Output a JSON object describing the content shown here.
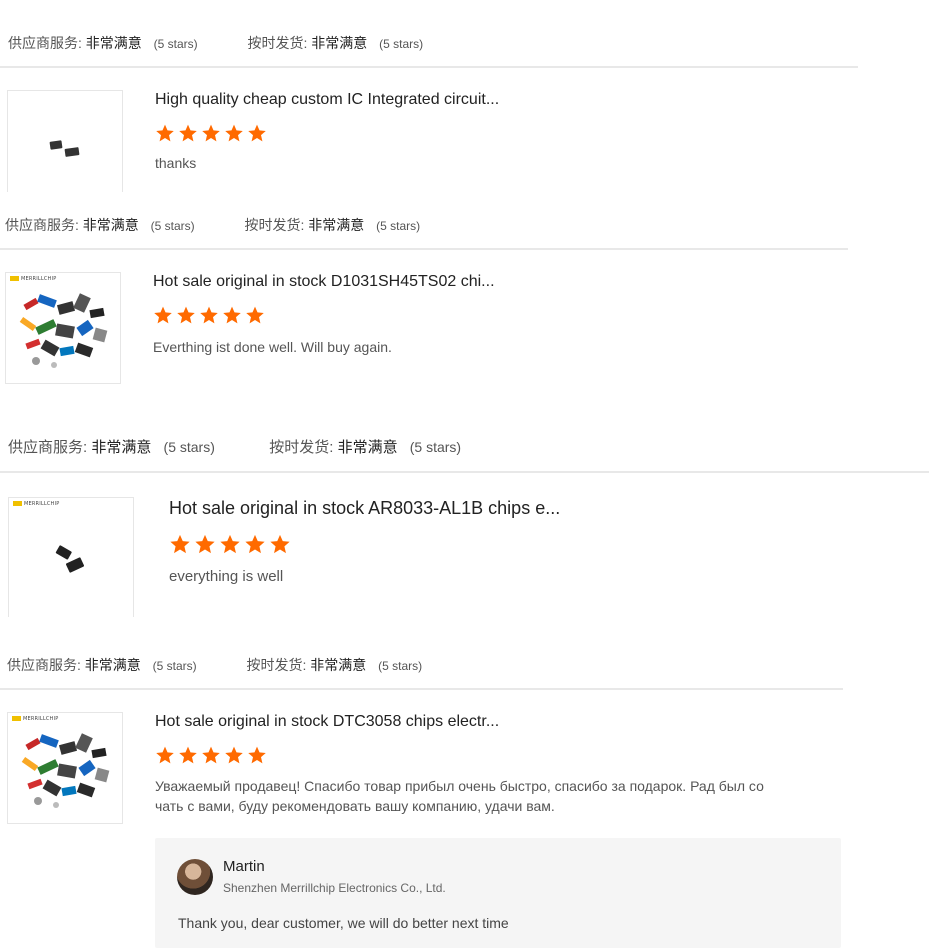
{
  "ratings": [
    {
      "service_label": "供应商服务:",
      "service_value": "非常满意",
      "service_stars": "(5 stars)",
      "delivery_label": "按时发货:",
      "delivery_value": "非常满意",
      "delivery_stars": "(5 stars)"
    },
    {
      "service_label": "供应商服务:",
      "service_value": "非常满意",
      "service_stars": "(5 stars)",
      "delivery_label": "按时发货:",
      "delivery_value": "非常满意",
      "delivery_stars": "(5 stars)"
    },
    {
      "service_label": "供应商服务:",
      "service_value": "非常满意",
      "service_stars": "(5 stars)",
      "delivery_label": "按时发货:",
      "delivery_value": "非常满意",
      "delivery_stars": "(5 stars)"
    },
    {
      "service_label": "供应商服务:",
      "service_value": "非常满意",
      "service_stars": "(5 stars)",
      "delivery_label": "按时发货:",
      "delivery_value": "非常满意",
      "delivery_stars": "(5 stars)"
    }
  ],
  "reviews": [
    {
      "title": "High quality cheap custom IC Integrated circuit...",
      "stars": 5,
      "comment": "thanks",
      "thumb_brand": ""
    },
    {
      "title": "Hot sale original in stock D1031SH45TS02 chi...",
      "stars": 5,
      "comment": "Everthing ist done well. Will buy again.",
      "thumb_brand": "MERRILLCHIP"
    },
    {
      "title": "Hot sale original in stock AR8033-AL1B chips e...",
      "stars": 5,
      "comment": "everything is well",
      "thumb_brand": "MERRILLCHIP"
    },
    {
      "title": "Hot sale original in stock DTC3058 chips electr...",
      "stars": 5,
      "comment_line1": "Уважаемый продавец! Спасибо товар прибыл очень быстро, спасибо за подарок. Рад был со",
      "comment_line2": "чать с вами, буду рекомендовать вашу компанию, удачи вам.",
      "thumb_brand": "MERRILLCHIP"
    }
  ],
  "reply": {
    "name": "Martin",
    "company": "Shenzhen Merrillchip Electronics Co., Ltd.",
    "text": "Thank you, dear customer, we will do better next time"
  },
  "colors": {
    "star": "#ff6a00",
    "divider": "#e8e8e8",
    "reply_bg": "#f5f5f5"
  },
  "icons": {
    "star": "star-icon",
    "avatar": "avatar"
  }
}
